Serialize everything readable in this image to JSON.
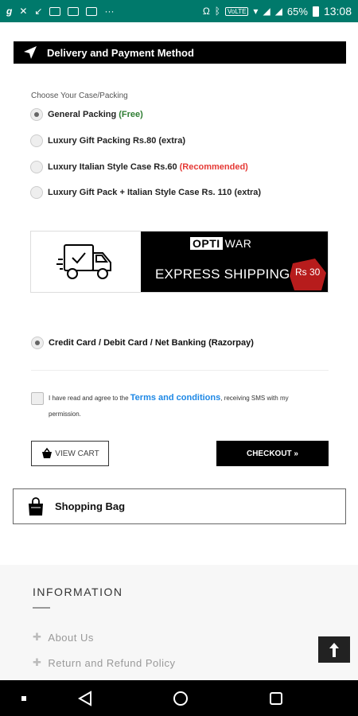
{
  "status_bar": {
    "battery": "65%",
    "time": "13:08",
    "volte": "VoLTE",
    "icons": [
      "g-icon",
      "x-icon",
      "missed-call-icon",
      "gallery-icon",
      "gallery-icon",
      "mail-icon",
      "more-icon",
      "headset-icon",
      "bluetooth-icon",
      "volte-icon",
      "wifi-icon",
      "signal-icon",
      "signal-icon",
      "battery-icon"
    ]
  },
  "delivery": {
    "title": "Delivery and Payment Method",
    "choose_label": "Choose Your Case/Packing",
    "options": [
      {
        "label": "General Packing",
        "extra": "(Free)",
        "extra_color": "#2e7d32",
        "checked": true
      },
      {
        "label": "Luxury Gift Packing Rs.80 (extra)",
        "extra": "",
        "checked": false
      },
      {
        "label": "Luxury Italian Style Case Rs.60",
        "extra": "(Recommended)",
        "extra_color": "#e53935",
        "checked": false
      },
      {
        "label": "Luxury Gift Pack + Italian Style Case Rs. 110 (extra)",
        "extra": "",
        "checked": false
      }
    ]
  },
  "banner": {
    "brand_left": "OPTI",
    "brand_right": "WAR",
    "headline": "EXPRESS SHIPPING",
    "price": "Rs 30"
  },
  "payment": {
    "label": "Credit Card / Debit Card / Net Banking (Razorpay)",
    "checked": true
  },
  "terms": {
    "prefix": "I have read and agree to the",
    "link": "Terms and conditions",
    "suffix": ", receiving SMS with my permission."
  },
  "buttons": {
    "view_cart": "VIEW CART",
    "checkout": "CHECKOUT »"
  },
  "shopping_bag": {
    "label": "Shopping Bag"
  },
  "footer": {
    "title": "INFORMATION",
    "links": [
      "About Us",
      "Return and Refund Policy"
    ]
  },
  "colors": {
    "status_bar": "#00796b",
    "link": "#1e88e5",
    "free": "#2e7d32",
    "recommended": "#e53935",
    "price_tag": "#b71c1c"
  }
}
